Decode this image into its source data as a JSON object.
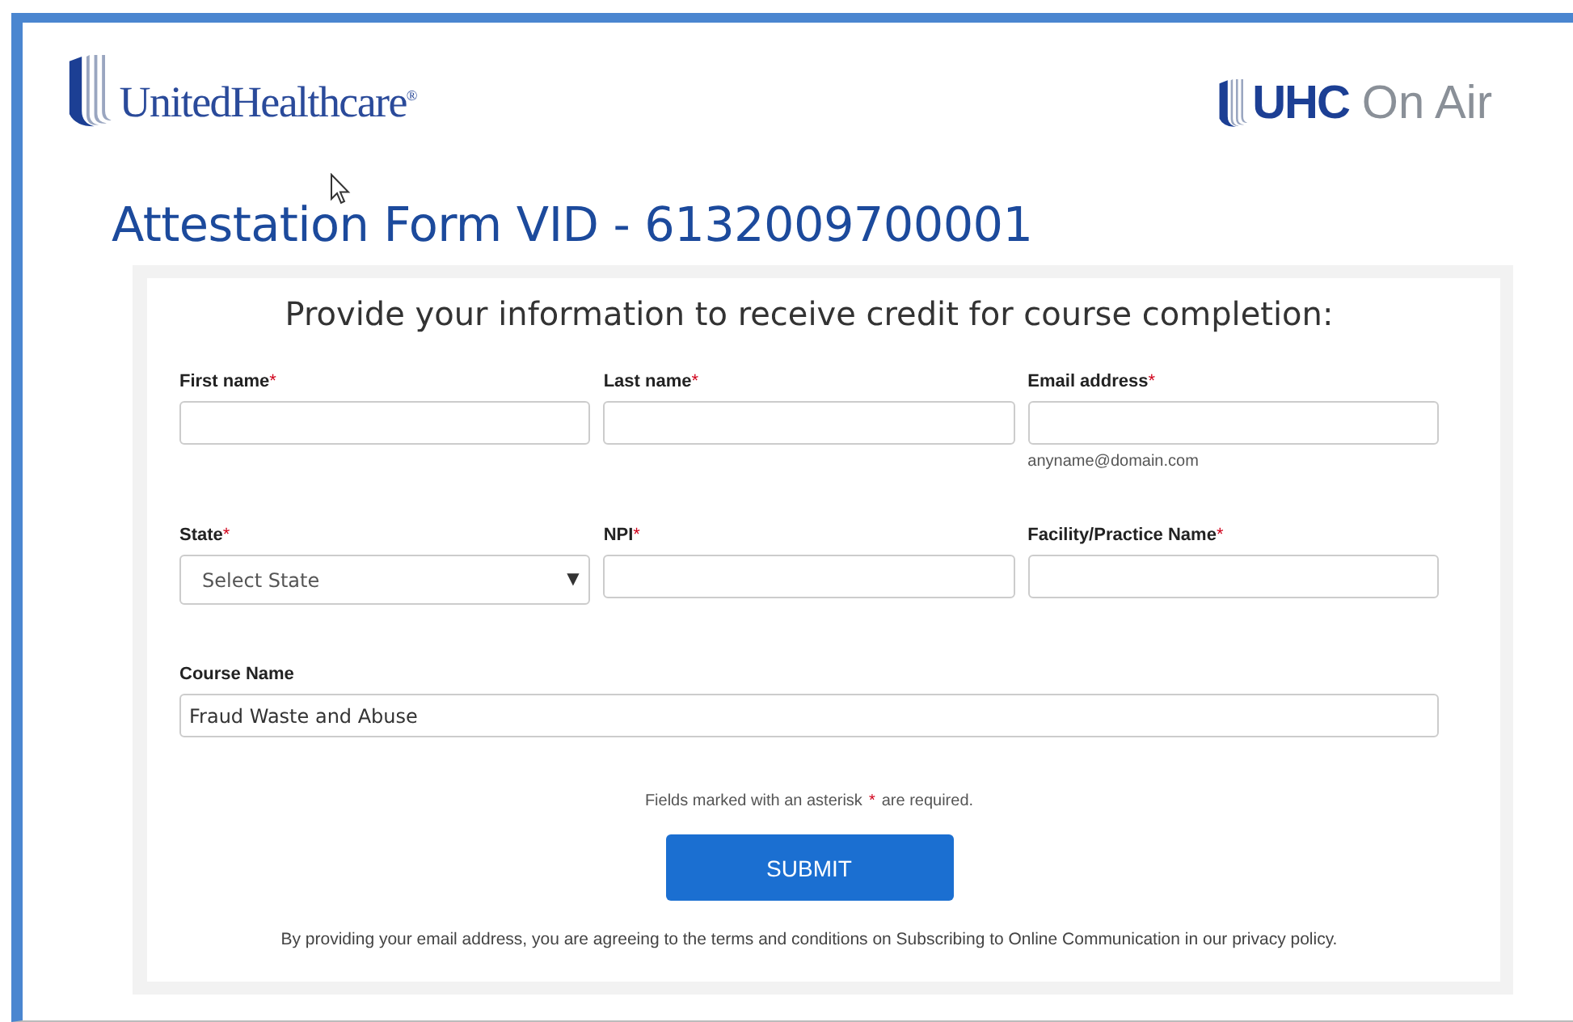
{
  "header": {
    "brand": "UnitedHealthcare",
    "brand_mark": "®",
    "partner_strong": "UHC",
    "partner_light": "On Air"
  },
  "title": "Attestation Form VID - 6132009700001",
  "form": {
    "heading": "Provide your information to receive credit for course completion:",
    "rows": [
      [
        {
          "kind": "text",
          "label": "First name",
          "asterisk": "*"
        },
        {
          "kind": "text",
          "label": "Last name",
          "asterisk": "*"
        },
        {
          "kind": "text",
          "label": "Email address",
          "asterisk": "*",
          "hint": "anyname@domain.com"
        }
      ],
      [
        {
          "kind": "select",
          "label": "State",
          "asterisk": "*",
          "placeholder": "Select State",
          "caret": "▼"
        },
        {
          "kind": "text",
          "label": "NPI",
          "asterisk": "*"
        },
        {
          "kind": "text",
          "label": "Facility/Practice Name",
          "asterisk": "*"
        }
      ],
      [
        {
          "kind": "wide",
          "label": "Course Name",
          "value": "Fraud Waste and Abuse"
        }
      ]
    ],
    "required_note": [
      "Fields marked with an asterisk",
      "*",
      "are required."
    ],
    "submit": "SUBMIT",
    "disclaimer": "By providing your email address, you are agreeing to the terms and conditions on Subscribing to Online Communication in our privacy policy."
  }
}
